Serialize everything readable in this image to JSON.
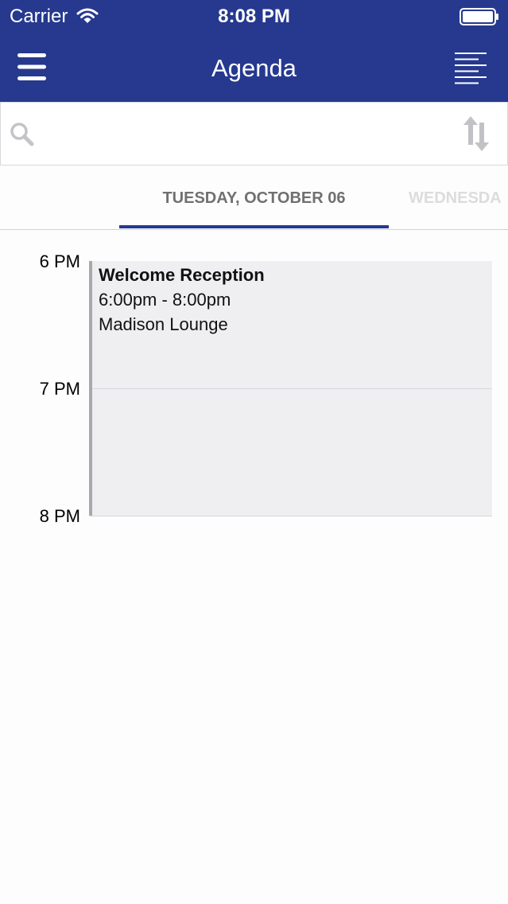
{
  "status_bar": {
    "carrier": "Carrier",
    "time": "8:08 PM"
  },
  "header": {
    "title": "Agenda",
    "left_icon": "menu-icon",
    "right_icon": "list-icon"
  },
  "search": {
    "value": "",
    "placeholder": "",
    "sort_icon": "sort-icon"
  },
  "tabs": [
    {
      "label": "TUESDAY, OCTOBER 06",
      "active": true
    },
    {
      "label": "WEDNESDA",
      "active": false
    }
  ],
  "timeline": {
    "hours": [
      "6 PM",
      "7 PM",
      "8 PM"
    ]
  },
  "events": [
    {
      "title": "Welcome Reception",
      "time": "6:00pm - 8:00pm",
      "location": "Madison Lounge"
    }
  ],
  "colors": {
    "brand": "#26398f",
    "event_bg": "#efeef1",
    "event_border": "#a8a8ad"
  }
}
